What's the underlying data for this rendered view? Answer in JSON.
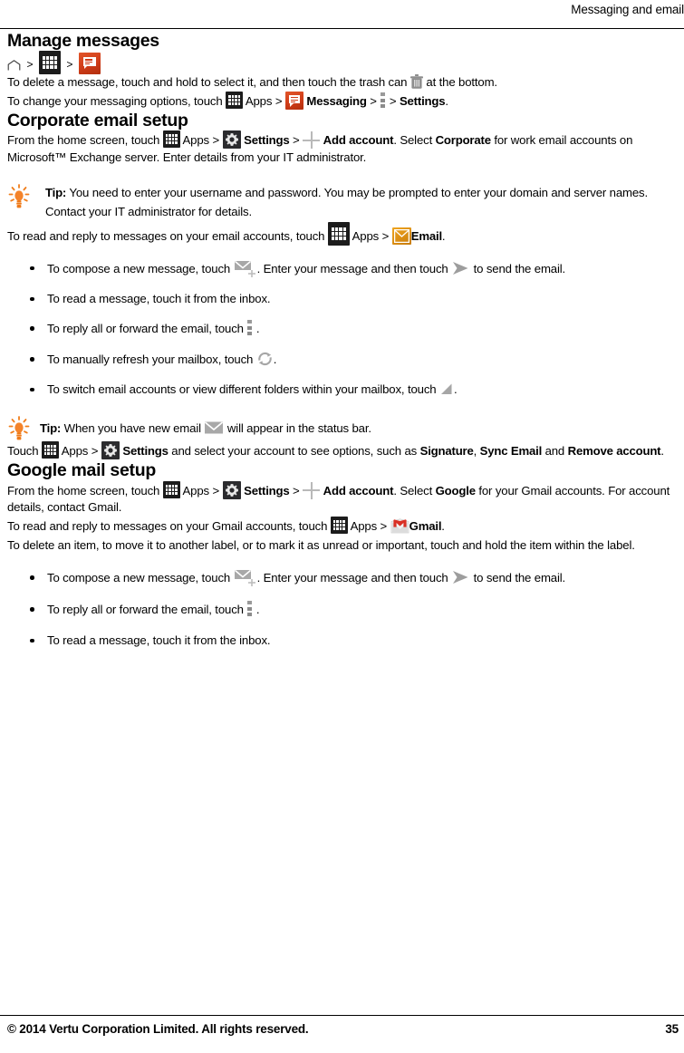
{
  "header": {
    "title": "Messaging and email"
  },
  "colors": {
    "messaging_icon": "#cf3c18",
    "email_icon": "#d98c13",
    "tip_bulb": "#f07d1a",
    "apps_icon": "#1c1c1c",
    "settings_icon": "#2b2b2e",
    "gmail_m": "#d93025",
    "grey_icon": "#9a9a9a"
  },
  "sections": [
    {
      "id": "manage-messages",
      "heading": "Manage messages",
      "breadcrumb": {
        "separator": ">",
        "items": [
          "home-icon",
          "apps-grid-icon",
          "messaging-icon"
        ]
      },
      "paragraphs": [
        {
          "id": "delete-message",
          "parts": [
            {
              "t": "text",
              "v": "To delete a message, touch and hold to select it, and then touch the trash can "
            },
            {
              "t": "icon",
              "v": "trash-icon"
            },
            {
              "t": "text",
              "v": " at the bottom."
            }
          ]
        },
        {
          "id": "messaging-options",
          "parts": [
            {
              "t": "text",
              "v": "To change your messaging options, touch "
            },
            {
              "t": "icon",
              "v": "apps-grid-icon"
            },
            {
              "t": "text",
              "v": " Apps > "
            },
            {
              "t": "icon",
              "v": "messaging-icon"
            },
            {
              "t": "bold",
              "v": "Messaging"
            },
            {
              "t": "text",
              "v": " > "
            },
            {
              "t": "icon",
              "v": "menu-icon"
            },
            {
              "t": "text",
              "v": " > "
            },
            {
              "t": "bold",
              "v": "Settings"
            },
            {
              "t": "text",
              "v": "."
            }
          ]
        }
      ]
    },
    {
      "id": "corporate-email-setup",
      "heading": "Corporate email setup",
      "intro": {
        "lead": "From the home screen, touch",
        "apps_label": "Apps",
        "settings_label": "Settings",
        "add_account_label": "Add account",
        "select_text": ". Select",
        "corporate_label": "Corporate",
        "tail": "for work email accounts on Microsoft™ Exchange server. Enter details from your IT administrator."
      },
      "tip": {
        "label": "Tip:",
        "text": "You need to enter your username and password. You may be prompted to enter your domain and server names. Contact your IT administrator for details."
      },
      "read_reply": {
        "lead": "To read and reply to messages on your email accounts, touch",
        "apps_label": "Apps",
        "email_label": "Email",
        "period": "."
      },
      "bullets": [
        {
          "id": "compose-email",
          "parts": [
            {
              "t": "text",
              "v": "To compose a new message, touch "
            },
            {
              "t": "icon",
              "v": "compose-envelope-icon"
            },
            {
              "t": "text",
              "v": ". Enter your message and then touch "
            },
            {
              "t": "icon",
              "v": "send-arrow-icon"
            },
            {
              "t": "text",
              "v": " to send the email."
            }
          ]
        },
        {
          "id": "read-message",
          "parts": [
            {
              "t": "text",
              "v": "To read a message, touch it from the inbox."
            }
          ]
        },
        {
          "id": "reply-forward",
          "parts": [
            {
              "t": "text",
              "v": "To reply all or forward the email, touch "
            },
            {
              "t": "icon",
              "v": "menu-icon"
            },
            {
              "t": "text",
              "v": "."
            }
          ]
        },
        {
          "id": "refresh-mailbox",
          "parts": [
            {
              "t": "text",
              "v": "To manually refresh your mailbox, touch "
            },
            {
              "t": "icon",
              "v": "refresh-icon"
            },
            {
              "t": "text",
              "v": "."
            }
          ]
        },
        {
          "id": "switch-accounts",
          "parts": [
            {
              "t": "text",
              "v": "To switch email accounts or view different folders within your mailbox, touch "
            },
            {
              "t": "icon",
              "v": "folder-triangle-icon"
            },
            {
              "t": "text",
              "v": "."
            }
          ]
        }
      ],
      "tip2": {
        "label": "Tip:",
        "before": "When you have new email",
        "after": "will appear in the status bar."
      },
      "account_options": {
        "touch_label": "Touch",
        "apps_label": "Apps",
        "settings_label": "Settings",
        "middle": "and select your account to see options, such as",
        "opt1": "Signature",
        "opt2": "Sync Email",
        "and": "and",
        "opt3": "Remove account",
        "period": "."
      }
    },
    {
      "id": "google-mail-setup",
      "heading": "Google mail setup",
      "intro": {
        "lead": "From the home screen, touch",
        "apps_label": "Apps",
        "settings_label": "Settings",
        "add_account_label": "Add account",
        "select_text": ". Select",
        "google_label": "Google",
        "tail": "for your Gmail accounts. For account details, contact Gmail."
      },
      "read_reply": {
        "lead": "To read and reply to messages on your Gmail accounts, touch",
        "apps_label": "Apps",
        "gmail_label": "Gmail",
        "period": "."
      },
      "delete_item": "To delete an item, to move it to another label, or to mark it as unread or important, touch and hold the item within the label.",
      "bullets": [
        {
          "id": "compose-gmail",
          "parts": [
            {
              "t": "text",
              "v": "To compose a new message, touch "
            },
            {
              "t": "icon",
              "v": "compose-envelope-icon"
            },
            {
              "t": "text",
              "v": ". Enter your message and then touch "
            },
            {
              "t": "icon",
              "v": "send-arrow-icon"
            },
            {
              "t": "text",
              "v": " to send the email."
            }
          ]
        },
        {
          "id": "reply-forward-gmail",
          "parts": [
            {
              "t": "text",
              "v": "To reply all or forward the email, touch "
            },
            {
              "t": "icon",
              "v": "menu-icon"
            },
            {
              "t": "text",
              "v": "."
            }
          ]
        },
        {
          "id": "read-message-gmail",
          "parts": [
            {
              "t": "text",
              "v": "To read a message, touch it from the inbox."
            }
          ]
        }
      ]
    }
  ],
  "footer": {
    "copyright": "© 2014 Vertu Corporation Limited. All rights reserved.",
    "page_number": "35"
  }
}
